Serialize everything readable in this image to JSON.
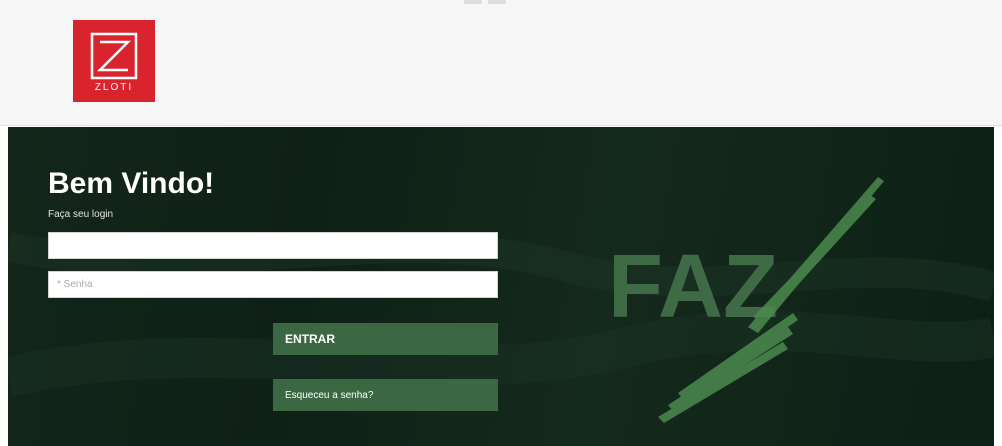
{
  "header": {
    "logo_text": "ZLOTI"
  },
  "login": {
    "title": "Bem Vindo!",
    "subtitle": "Faça seu login",
    "username_value": "",
    "username_placeholder": "",
    "password_placeholder": "* Senha",
    "enter_label": "ENTRAR",
    "forgot_label": "Esqueceu a senha?"
  },
  "brand": {
    "mark_text": "FAZ",
    "mark_color": "#3e6b45"
  },
  "colors": {
    "logo_red": "#d9232d",
    "hero_dark": "#12241a",
    "button_green": "#3b6843"
  }
}
